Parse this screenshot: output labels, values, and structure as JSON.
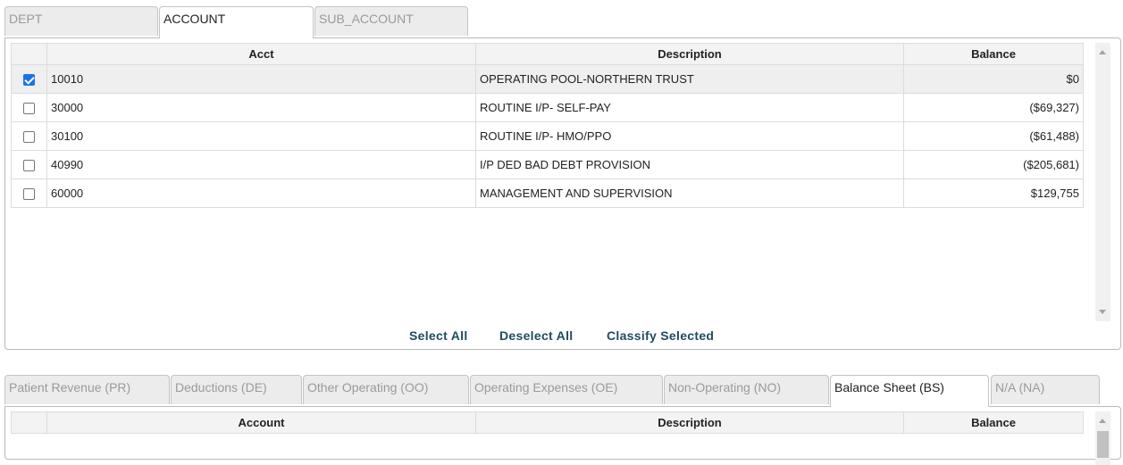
{
  "top_tabs": [
    "DEPT",
    "ACCOUNT",
    "SUB_ACCOUNT"
  ],
  "top_active_tab": "ACCOUNT",
  "top_table": {
    "headers": [
      "Acct",
      "Description",
      "Balance"
    ],
    "rows": [
      {
        "checked": true,
        "acct": "10010",
        "description": "OPERATING POOL-NORTHERN TRUST",
        "balance": "$0"
      },
      {
        "checked": false,
        "acct": "30000",
        "description": "ROUTINE I/P- SELF-PAY",
        "balance": "($69,327)"
      },
      {
        "checked": false,
        "acct": "30100",
        "description": "ROUTINE I/P- HMO/PPO",
        "balance": "($61,488)"
      },
      {
        "checked": false,
        "acct": "40990",
        "description": "I/P DED BAD DEBT PROVISION",
        "balance": "($205,681)"
      },
      {
        "checked": false,
        "acct": "60000",
        "description": "MANAGEMENT AND SUPERVISION",
        "balance": "$129,755"
      }
    ]
  },
  "actions": {
    "select_all": "Select All",
    "deselect_all": "Deselect All",
    "classify_selected": "Classify Selected"
  },
  "bottom_tabs": [
    "Patient Revenue (PR)",
    "Deductions (DE)",
    "Other Operating (OO)",
    "Operating Expenses (OE)",
    "Non-Operating (NO)",
    "Balance Sheet (BS)",
    "N/A (NA)"
  ],
  "bottom_active_tab": "Balance Sheet (BS)",
  "bottom_table": {
    "headers": [
      "Account",
      "Description",
      "Balance"
    ]
  },
  "colors": {
    "checkbox_checked": "#1a73e8",
    "action_link": "#1f4c5e",
    "inactive_tab_text": "#9a9a9a"
  }
}
